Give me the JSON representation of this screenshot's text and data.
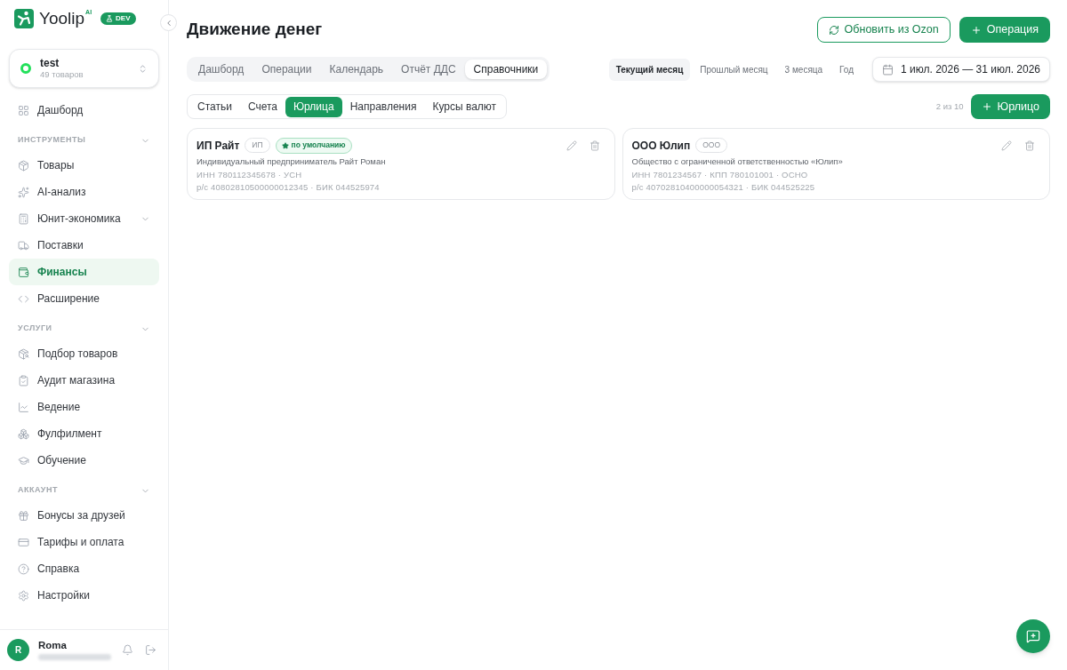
{
  "sidebar": {
    "logo": {
      "wordmark": "Yoolip",
      "superscript": "AI",
      "badge": "DEV"
    },
    "store": {
      "name": "test",
      "subtitle": "49 товаров"
    },
    "nav": [
      {
        "kind": "item",
        "label": "Дашборд",
        "selected": false
      },
      {
        "kind": "section",
        "label": "ИНСТРУМЕНТЫ",
        "expanded": true,
        "children": [
          {
            "kind": "item",
            "label": "Товары",
            "selected": false
          },
          {
            "kind": "item",
            "label": "AI-анализ",
            "selected": false
          },
          {
            "kind": "group",
            "label": "Юнит-экономика",
            "selected": false,
            "expanded": false
          },
          {
            "kind": "item",
            "label": "Поставки",
            "selected": false
          },
          {
            "kind": "item",
            "label": "Финансы",
            "selected": true
          },
          {
            "kind": "item",
            "label": "Расширение",
            "selected": false
          }
        ]
      },
      {
        "kind": "section",
        "label": "УСЛУГИ",
        "expanded": true,
        "children": [
          {
            "kind": "item",
            "label": "Подбор товаров",
            "selected": false
          },
          {
            "kind": "item",
            "label": "Аудит магазина",
            "selected": false
          },
          {
            "kind": "item",
            "label": "Ведение",
            "selected": false
          },
          {
            "kind": "item",
            "label": "Фулфилмент",
            "selected": false
          },
          {
            "kind": "item",
            "label": "Обучение",
            "selected": false
          }
        ]
      },
      {
        "kind": "section",
        "label": "АККАУНТ",
        "expanded": true,
        "children": [
          {
            "kind": "item",
            "label": "Бонусы за друзей",
            "selected": false
          },
          {
            "kind": "item",
            "label": "Тарифы и оплата",
            "selected": false
          },
          {
            "kind": "item",
            "label": "Справка",
            "selected": false
          },
          {
            "kind": "item",
            "label": "Настройки",
            "selected": false
          }
        ]
      }
    ],
    "user": {
      "name": "Roma",
      "initial": "R"
    }
  },
  "header": {
    "title": "Движение денег",
    "actions": [
      {
        "kind": "outline",
        "label": "Обновить из Ozon"
      },
      {
        "kind": "primary",
        "label": "Операция"
      }
    ]
  },
  "tabs": [
    {
      "label": "Дашборд",
      "selected": false
    },
    {
      "label": "Операции",
      "selected": false
    },
    {
      "label": "Календарь",
      "selected": false
    },
    {
      "label": "Отчёт ДДС",
      "selected": false
    },
    {
      "label": "Справочники",
      "selected": true
    }
  ],
  "periods": [
    {
      "label": "Текущий месяц",
      "selected": true
    },
    {
      "label": "Прошлый месяц",
      "selected": false
    },
    {
      "label": "3 месяца",
      "selected": false
    },
    {
      "label": "Год",
      "selected": false
    }
  ],
  "date_range": {
    "value": "1 июл. 2026 — 31 июл. 2026"
  },
  "subtabs": [
    {
      "label": "Статьи",
      "selected": false
    },
    {
      "label": "Счета",
      "selected": false
    },
    {
      "label": "Юрлица",
      "selected": true
    },
    {
      "label": "Направления",
      "selected": false
    },
    {
      "label": "Курсы валют",
      "selected": false
    }
  ],
  "counter": "2 из 10",
  "add_button": {
    "label": "Юрлицо"
  },
  "entities": [
    {
      "name": "ИП Райт",
      "type": "ИП",
      "badge": "по умолчанию",
      "full_name": "Индивидуальный предприниматель Райт Роман",
      "details": [
        "ИНН 780112345678 · УСН",
        "р/с 40802810500000012345 · БИК 044525974"
      ]
    },
    {
      "name": "ООО Юлип",
      "type": "ООО",
      "full_name": "Общество с ограниченной ответственностью «Юлип»",
      "details": [
        "ИНН 7801234567 · КПП 780101001 · ОСНО",
        "р/с 40702810400000054321 · БИК 044525225"
      ]
    }
  ]
}
